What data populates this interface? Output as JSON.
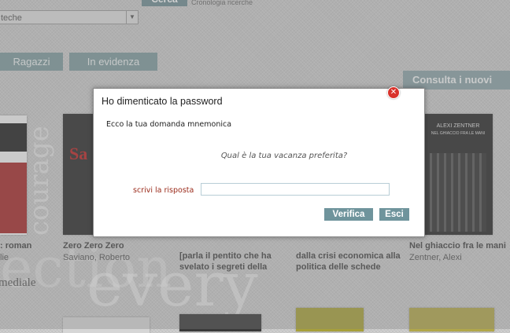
{
  "topbar": {
    "search_button": "Cerca",
    "history_link": "Cronologia ricerche",
    "select_value": "teche"
  },
  "tabs": [
    {
      "label": "Ragazzi"
    },
    {
      "label": "In evidenza"
    }
  ],
  "consulta_label": "Consulta i nuovi",
  "books": [
    {
      "title": ": roman",
      "author": "lie",
      "color": "#8b1f1f"
    },
    {
      "title": "Zero Zero Zero",
      "author": "Saviano, Roberto",
      "color": "#3a3a3a"
    },
    {
      "title": "[parla il pentito che ha",
      "title2": "svelato i segreti della",
      "color": "#4a4a4a"
    },
    {
      "title": "dalla crisi economica alla",
      "title2": "politica delle schede",
      "color": "#5a5a5a"
    },
    {
      "title": "Nel ghiaccio fra le mani",
      "author": "Zentner, Alexi",
      "color": "#2f2f2f"
    }
  ],
  "section_label": "mediale",
  "decorative_words": [
    "courage",
    "every",
    "ection"
  ],
  "modal": {
    "title": "Ho dimenticato la password",
    "subtitle": "Ecco la tua domanda mnemonica",
    "question": "Qual è la tua vacanza preferita?",
    "answer_label": "scrivi la risposta",
    "answer_value": "",
    "verify_button": "Verifica",
    "exit_button": "Esci",
    "close_icon": "close-icon"
  }
}
